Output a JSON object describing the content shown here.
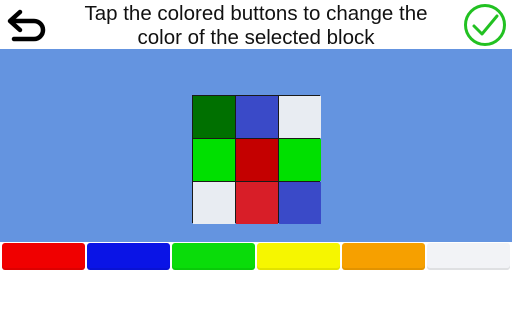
{
  "header": {
    "instruction_line1": "Tap the colored buttons to change the",
    "instruction_line2": "color of the selected block"
  },
  "icons": {
    "back": "back-arrow-icon",
    "confirm": "checkmark-circle-icon"
  },
  "colors": {
    "stage_bg": "#6494e0",
    "confirm_green": "#22c122"
  },
  "grid": {
    "rows": 3,
    "cols": 3,
    "cells": [
      "#007000",
      "#3a4ac8",
      "#e8ecf2",
      "#00e000",
      "#c40000",
      "#00e000",
      "#e8ecf2",
      "#d81e28",
      "#3a4ac8"
    ]
  },
  "palette": [
    {
      "name": "red",
      "color": "#f00000"
    },
    {
      "name": "blue",
      "color": "#0a14e6"
    },
    {
      "name": "green",
      "color": "#0adc0a"
    },
    {
      "name": "yellow",
      "color": "#f6f600"
    },
    {
      "name": "orange",
      "color": "#f6a000"
    },
    {
      "name": "white",
      "color": "#f2f3f6"
    }
  ]
}
